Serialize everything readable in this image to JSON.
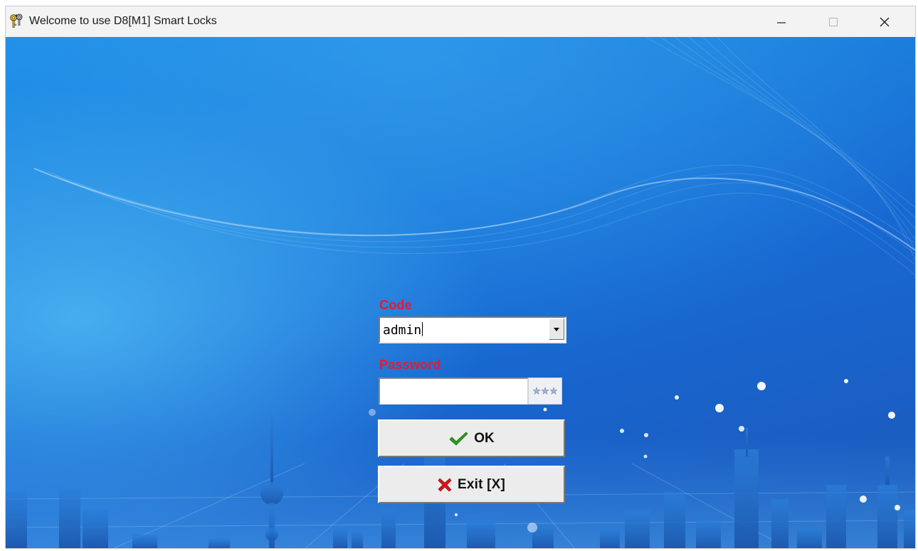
{
  "window": {
    "title": "Welcome to use D8[M1] Smart Locks",
    "icons": {
      "app": "keys-icon",
      "minimize": "minimize-icon",
      "maximize": "maximize-icon",
      "close": "close-icon"
    }
  },
  "login": {
    "code_label": "Code",
    "code_value": "admin",
    "password_label": "Password",
    "password_value": "",
    "ok_label": "OK",
    "exit_label": "Exit [X]"
  },
  "colors": {
    "label": "#e8192c",
    "background": "#1a75d8",
    "ok_check": "#2e9a1a",
    "exit_cross": "#d8141c"
  }
}
